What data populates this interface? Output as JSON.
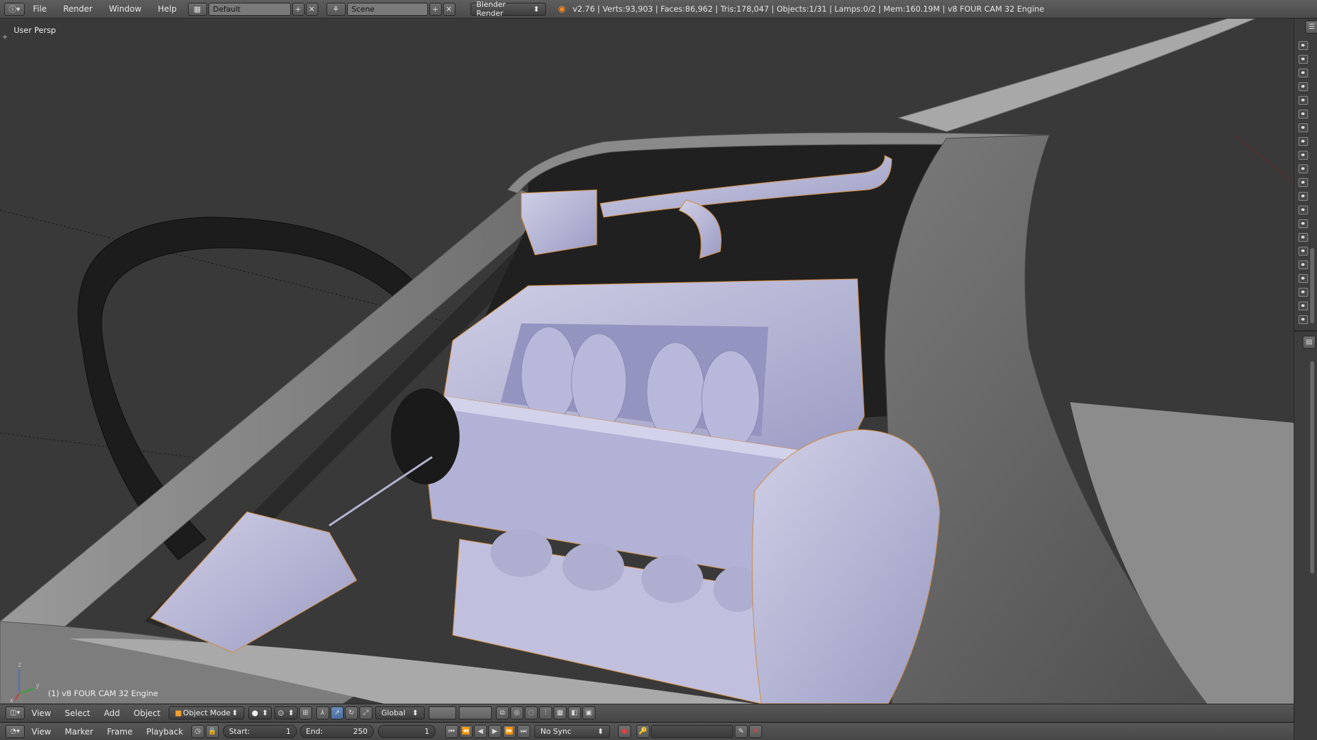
{
  "topbar": {
    "menus": [
      "File",
      "Render",
      "Window",
      "Help"
    ],
    "screen_layout": "Default",
    "scene": "Scene",
    "render_engine": "Blender Render",
    "stats": "v2.76 | Verts:93,903 | Faces:86,962 | Tris:178,047 | Objects:1/31 | Lamps:0/2 | Mem:160.19M | v8 FOUR CAM 32 Engine"
  },
  "viewport": {
    "view_label": "User Persp",
    "object_label": "(1) v8 FOUR CAM 32 Engine",
    "axis_labels": {
      "x": "x",
      "y": "y",
      "z": "z"
    }
  },
  "view3d_header": {
    "menus": [
      "View",
      "Select",
      "Add",
      "Object"
    ],
    "mode": "Object Mode",
    "orientation": "Global"
  },
  "timeline_header": {
    "menus": [
      "View",
      "Marker",
      "Frame",
      "Playback"
    ],
    "start_label": "Start:",
    "start_value": "1",
    "end_label": "End:",
    "end_value": "250",
    "current_frame": "1",
    "sync": "No Sync"
  },
  "colors": {
    "viewport_bg": "#393939",
    "mesh_selected": "#b4b4d2",
    "mesh_grey": "#8a8a8a",
    "outline_selected": "#f0962a"
  }
}
